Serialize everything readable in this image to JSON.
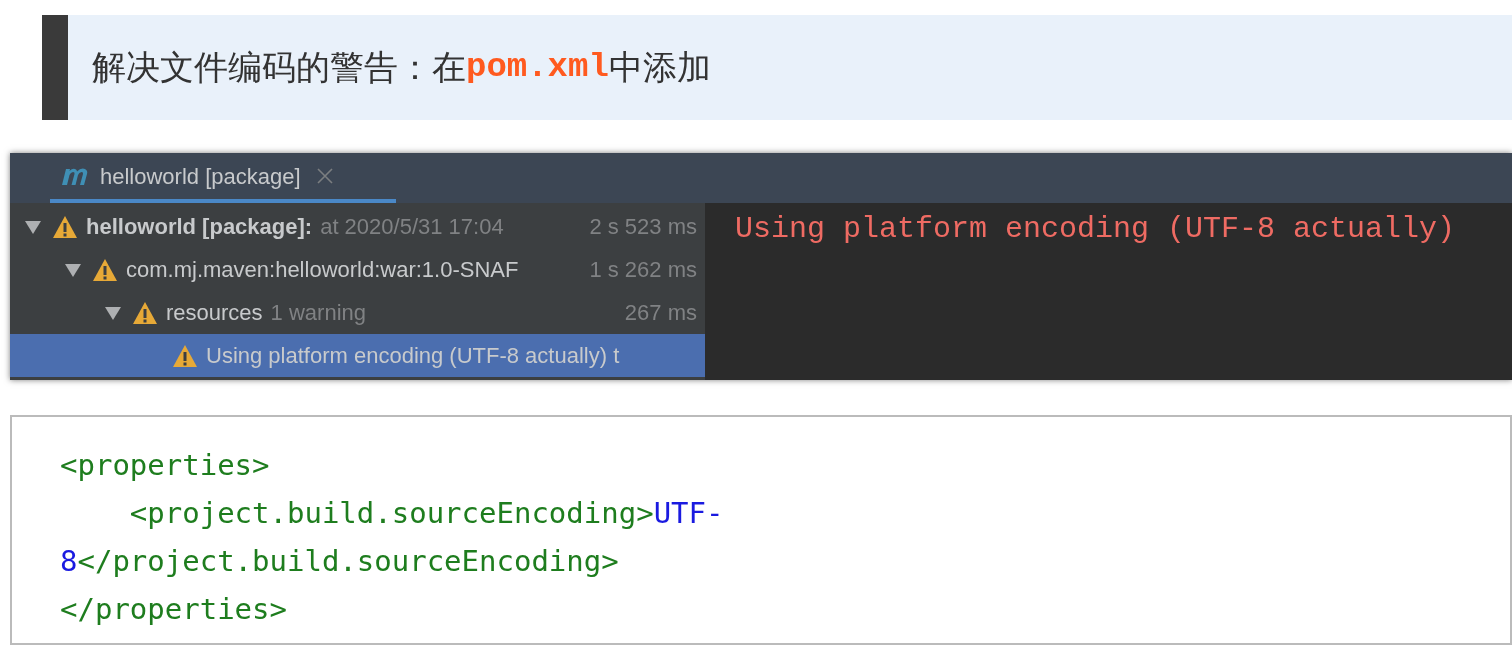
{
  "heading": {
    "parts": [
      {
        "kind": "plain",
        "text": "解决文件编码的警告：在"
      },
      {
        "kind": "code",
        "text": "pom.xml"
      },
      {
        "kind": "plain",
        "text": "中添加"
      }
    ]
  },
  "ide": {
    "tab": {
      "title": "helloworld [package]",
      "selected": true
    },
    "tree": [
      {
        "label": "helloworld [package]:",
        "detail": "at 2020/5/31 17:04",
        "time": "2 s 523 ms",
        "expanded": true,
        "selected": false,
        "children": [
          {
            "label": "com.mj.maven:helloworld:war:1.0-SNAF",
            "time": "1 s 262 ms",
            "expanded": true,
            "selected": false,
            "children": [
              {
                "label": "resources",
                "detail": "1 warning",
                "time": "267 ms",
                "expanded": true,
                "selected": false,
                "children": [
                  {
                    "label": "Using platform encoding (UTF-8 actually) t",
                    "selected": true
                  }
                ]
              }
            ]
          }
        ]
      }
    ],
    "console": "Using platform encoding (UTF-8 actually)"
  },
  "code": [
    [
      {
        "kind": "tag",
        "text": "<properties>"
      }
    ],
    [
      {
        "kind": "tag",
        "text": "    <project.build.sourceEncoding>"
      },
      {
        "kind": "value",
        "text": "UTF-"
      }
    ],
    [
      {
        "kind": "value",
        "text": "8"
      },
      {
        "kind": "tag",
        "text": "</project.build.sourceEncoding>"
      }
    ],
    [
      {
        "kind": "tag",
        "text": "</properties>"
      }
    ]
  ]
}
